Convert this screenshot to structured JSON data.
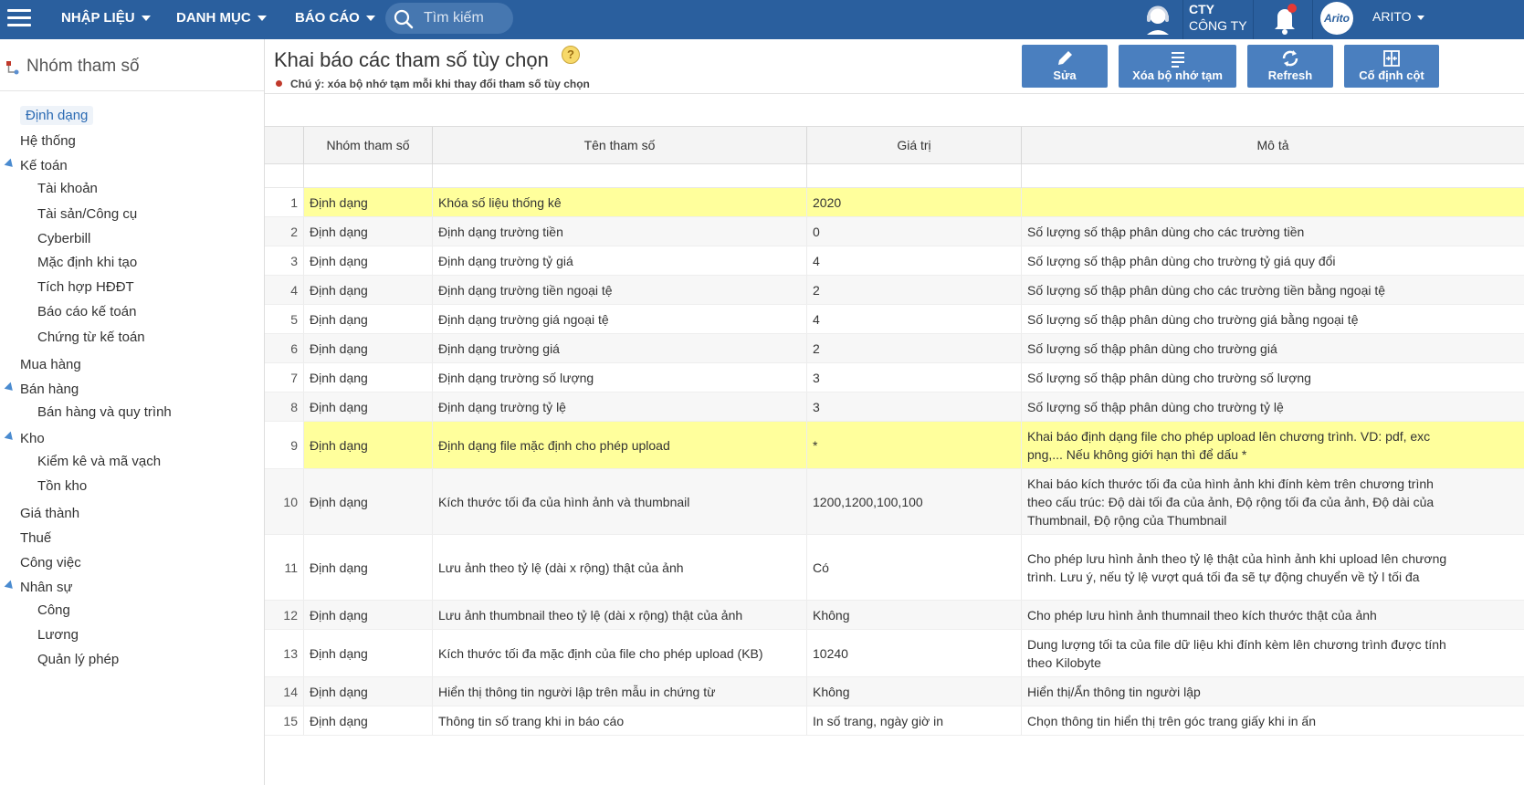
{
  "topbar": {
    "menus": [
      "NHẬP LIỆU",
      "DANH MỤC",
      "BÁO CÁO"
    ],
    "search_placeholder": "Tìm kiếm",
    "company_line1": "CTY",
    "company_line2": "CÔNG TY",
    "avatar_text": "Arito",
    "user_name": "ARITO",
    "colors": {
      "bar": "#2a5f9e",
      "notification_dot": "#e53935"
    }
  },
  "sidebar": {
    "title": "Nhóm tham số",
    "items": [
      "Định dạng",
      "Hệ thống",
      "Kế toán",
      "Tài khoản",
      "Tài sản/Công cụ",
      "Cyberbill",
      "Mặc định khi tạo",
      "Tích hợp HĐĐT",
      "Báo cáo kế toán",
      "Chứng từ kế toán",
      "Mua hàng",
      "Bán hàng",
      "Bán hàng và quy trình",
      "Kho",
      "Kiểm kê và mã vạch",
      "Tồn kho",
      "Giá thành",
      "Thuế",
      "Công việc",
      "Nhân sự",
      "Công",
      "Lương",
      "Quản lý phép"
    ]
  },
  "page": {
    "title": "Khai báo các tham số tùy chọn",
    "help": "?",
    "note": "Chú ý: xóa bộ nhớ tạm mỗi khi thay đổi tham số tùy chọn"
  },
  "toolbar": {
    "edit": "Sửa",
    "clear_cache": "Xóa bộ nhớ tạm",
    "refresh": "Refresh",
    "freeze": "Cố định cột"
  },
  "grid": {
    "columns": [
      "Nhóm tham số",
      "Tên tham số",
      "Giá trị",
      "Mô tả"
    ],
    "rows": [
      {
        "no": "1",
        "group": "Định dạng",
        "name": "Khóa số liệu thống kê",
        "value": "2020",
        "desc": ""
      },
      {
        "no": "2",
        "group": "Định dạng",
        "name": "Định dạng trường tiền",
        "value": "0",
        "desc": "Số lượng số thập phân dùng cho các trường tiền"
      },
      {
        "no": "3",
        "group": "Định dạng",
        "name": "Định dạng trường tỷ giá",
        "value": "4",
        "desc": "Số lượng số thập phân dùng cho trường tỷ giá quy đổi"
      },
      {
        "no": "4",
        "group": "Định dạng",
        "name": "Định dạng trường tiền ngoại tệ",
        "value": "2",
        "desc": "Số lượng số thập phân dùng cho các trường tiền bằng ngoại tệ"
      },
      {
        "no": "5",
        "group": "Định dạng",
        "name": "Định dạng trường giá ngoại tệ",
        "value": "4",
        "desc": "Số lượng số thập phân dùng cho trường giá bằng ngoại tệ"
      },
      {
        "no": "6",
        "group": "Định dạng",
        "name": "Định dạng trường giá",
        "value": "2",
        "desc": "Số lượng số thập phân dùng cho trường giá"
      },
      {
        "no": "7",
        "group": "Định dạng",
        "name": "Định dạng trường số lượng",
        "value": "3",
        "desc": "Số lượng số thập phân dùng cho trường số lượng"
      },
      {
        "no": "8",
        "group": "Định dạng",
        "name": "Định dạng trường tỷ lệ",
        "value": "3",
        "desc": "Số lượng số thập phân dùng cho trường tỷ lệ"
      },
      {
        "no": "9",
        "group": "Định dạng",
        "name": "Định dạng file mặc định cho phép upload",
        "value": "*",
        "desc": "Khai báo định dạng file cho phép upload lên chương trình. VD: pdf, exc png,... Nếu không giới hạn thì để dấu *"
      },
      {
        "no": "10",
        "group": "Định dạng",
        "name": "Kích thước tối đa của hình ảnh và thumbnail",
        "value": "1200,1200,100,100",
        "desc": "Khai báo kích thước tối đa của hình ảnh khi đính kèm trên chương trình theo cấu trúc: Độ dài tối đa của ảnh, Độ rộng tối đa của ảnh, Độ dài của Thumbnail, Độ rộng của Thumbnail"
      },
      {
        "no": "11",
        "group": "Định dạng",
        "name": "Lưu ảnh theo tỷ lệ (dài x rộng) thật của ảnh",
        "value": "Có",
        "desc": "Cho phép lưu hình ảnh theo tỷ lệ thật của hình ảnh khi upload lên chương trình. Lưu ý, nếu tỷ lệ vượt quá tối đa sẽ tự động chuyển về tỷ l tối đa"
      },
      {
        "no": "12",
        "group": "Định dạng",
        "name": "Lưu ảnh thumbnail theo tỷ lệ (dài x rộng) thật của ảnh",
        "value": "Không",
        "desc": "Cho phép lưu hình ảnh thumnail theo kích thước thật của ảnh"
      },
      {
        "no": "13",
        "group": "Định dạng",
        "name": "Kích thước tối đa mặc định của file cho phép upload (KB)",
        "value": "10240",
        "desc": "Dung lượng tối ta của file dữ liệu khi đính kèm lên chương trình được tính theo Kilobyte"
      },
      {
        "no": "14",
        "group": "Định dạng",
        "name": "Hiển thị thông tin người lập trên mẫu in chứng từ",
        "value": "Không",
        "desc": "Hiển thị/Ẩn thông tin người lập"
      },
      {
        "no": "15",
        "group": "Định dạng",
        "name": "Thông tin số trang khi in báo cáo",
        "value": "In số trang, ngày giờ in",
        "desc": "Chọn thông tin hiển thị trên góc trang giấy khi in ấn"
      }
    ]
  }
}
